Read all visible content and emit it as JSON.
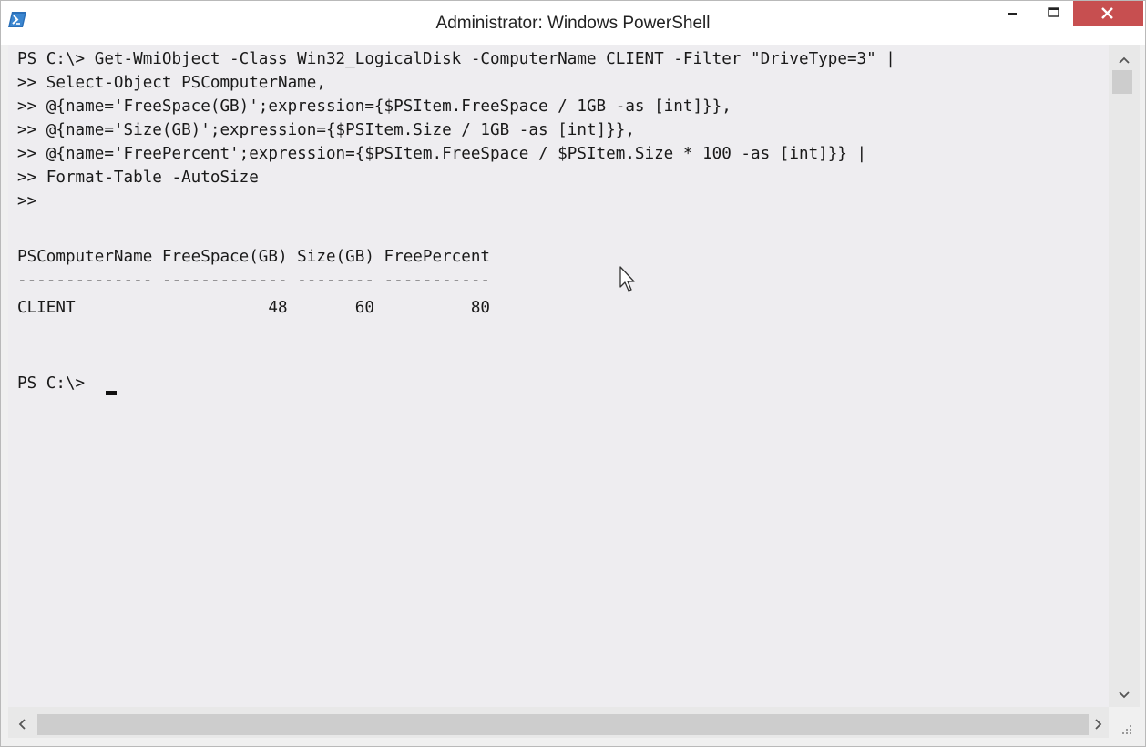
{
  "window": {
    "title": "Administrator: Windows PowerShell",
    "accent_close": "#c74f50",
    "icon": "powershell-icon"
  },
  "console": {
    "background": "#eeedf0",
    "lines": [
      "PS C:\\> Get-WmiObject -Class Win32_LogicalDisk -ComputerName CLIENT -Filter \"DriveType=3\" |",
      ">> Select-Object PSComputerName,",
      ">> @{name='FreeSpace(GB)';expression={$PSItem.FreeSpace / 1GB -as [int]}},",
      ">> @{name='Size(GB)';expression={$PSItem.Size / 1GB -as [int]}},",
      ">> @{name='FreePercent';expression={$PSItem.FreeSpace / $PSItem.Size * 100 -as [int]}} |",
      ">> Format-Table -AutoSize",
      ">>",
      "",
      "PSComputerName FreeSpace(GB) Size(GB) FreePercent",
      "-------------- ------------- -------- -----------",
      "CLIENT                    48       60          80",
      "",
      "",
      "PS C:\\> "
    ],
    "table": {
      "headers": [
        "PSComputerName",
        "FreeSpace(GB)",
        "Size(GB)",
        "FreePercent"
      ],
      "rows": [
        [
          "CLIENT",
          "48",
          "60",
          "80"
        ]
      ]
    }
  },
  "icons": {
    "minimize": "minimize-icon",
    "maximize": "maximize-icon",
    "close": "close-icon",
    "scroll_up": "chevron-up-icon",
    "scroll_down": "chevron-down-icon",
    "scroll_left": "chevron-left-icon",
    "scroll_right": "chevron-right-icon",
    "resize_grip": "resize-grip-icon",
    "mouse_pointer": "mouse-pointer-icon"
  }
}
